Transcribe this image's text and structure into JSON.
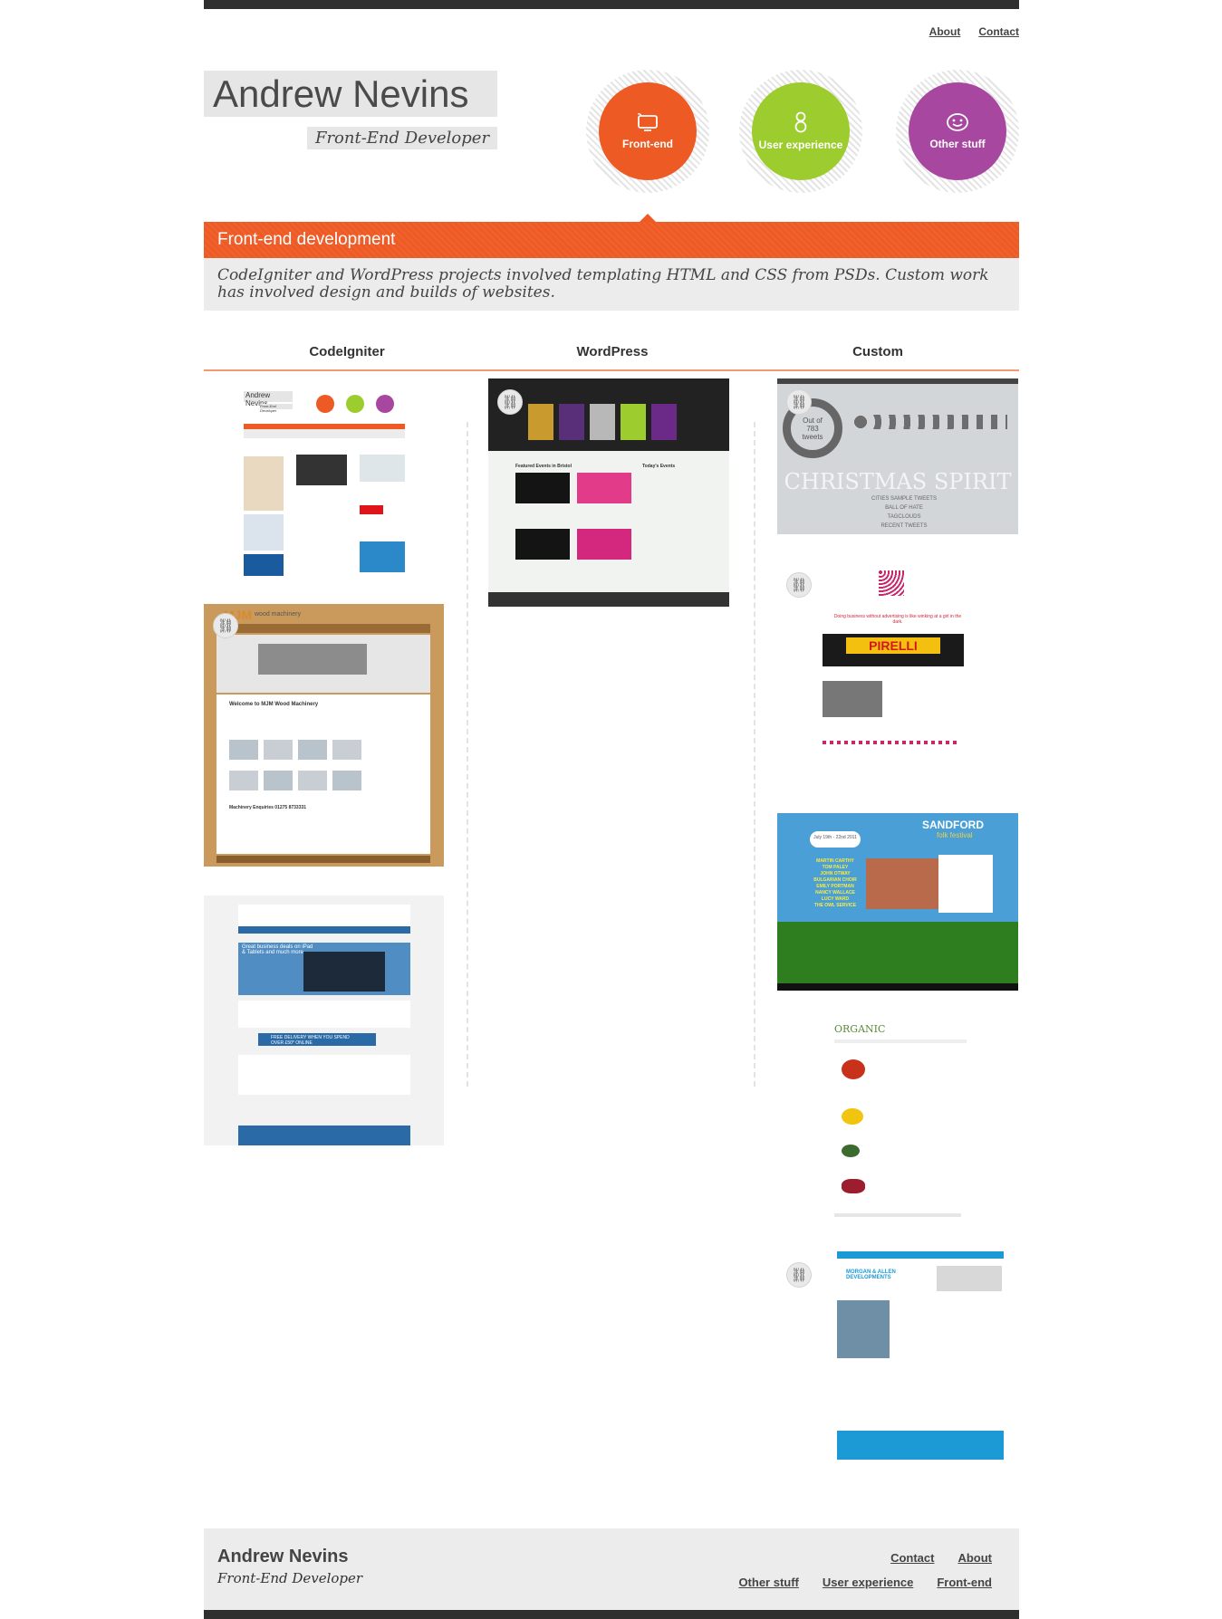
{
  "nav": {
    "about": "About",
    "contact": "Contact"
  },
  "brand": {
    "name": "Andrew Nevins",
    "role": "Front-End Developer"
  },
  "skills": [
    {
      "label": "Front-end",
      "color": "#ee5a24",
      "icon": "monitor-icon"
    },
    {
      "label": "User experience",
      "color": "#9ccc2d",
      "icon": "person-icon"
    },
    {
      "label": "Other stuff",
      "color": "#a8479f",
      "icon": "smiley-icon"
    }
  ],
  "section": {
    "title": "Front-end development",
    "description": "CodeIgniter and WordPress projects involved templating HTML and CSS from PSDs. Custom work has involved design and builds of websites."
  },
  "columns": {
    "codeigniter": "CodeIgniter",
    "wordpress": "WordPress",
    "custom": "Custom"
  },
  "thumbs": {
    "ci1": {
      "title": "Andrew Nevins",
      "subtitle": "Front-End Developer"
    },
    "ci2": {
      "logo": "MJM",
      "tag": "wood machinery",
      "heading": "Welcome to MJM Wood Machinery",
      "enquiries": "Machinery Enquiries 01275 8733331"
    },
    "ci3": {
      "banner": "Great business deals on iPad & Tablets and much more",
      "delivery": "FREE DELIVERY WHEN YOU SPEND OVER £50* ONLINE"
    },
    "wp1": {
      "featured": "Featured Events in Bristol",
      "today": "Today's Events"
    },
    "cu1": {
      "count": "Out of 783 tweets",
      "headline": "CHRISTMAS SPIRIT",
      "menu": [
        "CITIES SAMPLE TWEETS",
        "BALL OF HATE",
        "TAGCLOUDS",
        "RECENT TWEETS"
      ]
    },
    "cu2": {
      "brand": "PIRELLI",
      "quote": "Doing business without advertising is like winking at a girl in the dark."
    },
    "cu3": {
      "title": "SANDFORD",
      "subtitle": "folk festival",
      "date": "July 19th - 22nd 2011",
      "acts": [
        "MARTIN CARTHY",
        "TOM PALEY",
        "JOHN OTWAY",
        "BULGARIAN CHOIR",
        "EMILY PORTMAN",
        "NANCY WALLACE",
        "LUCY WARD",
        "THE OWL SERVICE"
      ]
    },
    "cu4": {
      "logo": "ORGANIC"
    },
    "cu5": {
      "logo": "MORGAN & ALLEN DEVELOPMENTS"
    }
  },
  "footer": {
    "name": "Andrew Nevins",
    "role": "Front-End Developer",
    "links_top": [
      "Contact",
      "About"
    ],
    "links_bottom": [
      "Other stuff",
      "User experience",
      "Front-end"
    ]
  }
}
